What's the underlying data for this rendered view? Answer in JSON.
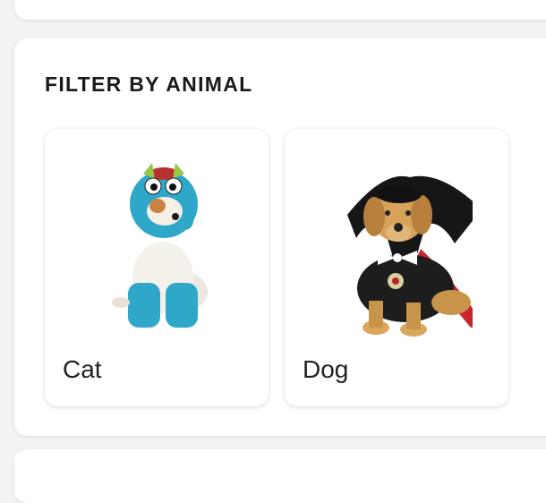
{
  "filter": {
    "heading": "FILTER BY ANIMAL",
    "options": [
      {
        "label": "Cat",
        "image": "cat-costume-photo"
      },
      {
        "label": "Dog",
        "image": "dog-vampire-costume-photo"
      }
    ]
  },
  "colors": {
    "page_background": "#f3f3f3",
    "card_background": "#ffffff",
    "heading_text": "#1a1a1a",
    "label_text": "#222222"
  }
}
